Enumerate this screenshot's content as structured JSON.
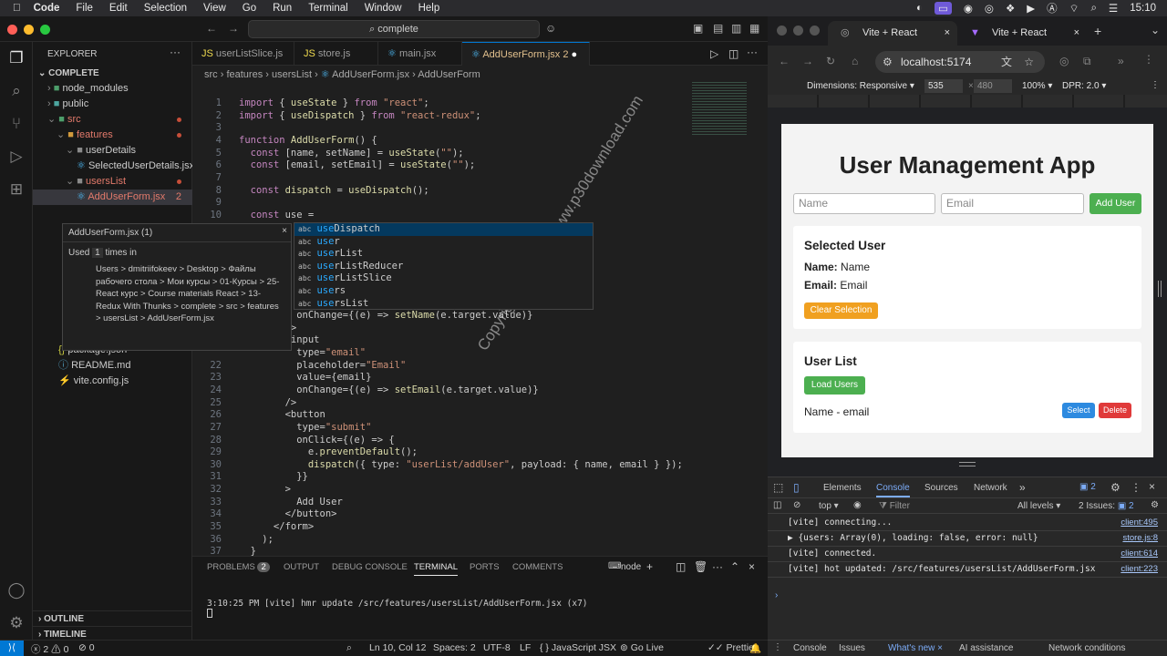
{
  "menubar": {
    "app": "Code",
    "items": [
      "File",
      "Edit",
      "Selection",
      "View",
      "Go",
      "Run",
      "Terminal",
      "Window",
      "Help"
    ],
    "clock": "15:10"
  },
  "vscode": {
    "command_center": "complete",
    "explorer_title": "EXPLORER",
    "project": "COMPLETE",
    "tree": [
      {
        "label": "node_modules",
        "depth": 1,
        "type": "folder"
      },
      {
        "label": "public",
        "depth": 1,
        "type": "folder"
      },
      {
        "label": "src",
        "depth": 1,
        "type": "folder-open"
      },
      {
        "label": "features",
        "depth": 2,
        "type": "folder-open"
      },
      {
        "label": "userDetails",
        "depth": 3,
        "type": "folder-open"
      },
      {
        "label": "SelectedUserDetails.jsx",
        "depth": 4,
        "type": "file"
      },
      {
        "label": "usersList",
        "depth": 3,
        "type": "folder-open"
      },
      {
        "label": "AddUserForm.jsx",
        "depth": 4,
        "type": "file",
        "badge": "2"
      }
    ],
    "tree_bottom": [
      {
        "label": "package.json"
      },
      {
        "label": "README.md"
      },
      {
        "label": "vite.config.js"
      }
    ],
    "outline": "OUTLINE",
    "timeline": "TIMELINE",
    "tabs": [
      {
        "label": "userListSlice.js"
      },
      {
        "label": "store.js"
      },
      {
        "label": "main.jsx"
      },
      {
        "label": "AddUserForm.jsx",
        "badge": "2"
      }
    ],
    "breadcrumbs": [
      "src",
      "features",
      "usersList",
      "AddUserForm.jsx",
      "AddUserForm"
    ],
    "code": [
      {
        "n": "1",
        "text": "import { useState } from \"react\";"
      },
      {
        "n": "2",
        "text": "import { useDispatch } from \"react-redux\";"
      },
      {
        "n": "3",
        "text": ""
      },
      {
        "n": "4",
        "text": "function AddUserForm() {"
      },
      {
        "n": "5",
        "text": "  const [name, setName] = useState(\"\");"
      },
      {
        "n": "6",
        "text": "  const [email, setEmail] = useState(\"\");"
      },
      {
        "n": "7",
        "text": ""
      },
      {
        "n": "8",
        "text": "  const dispatch = useDispatch();"
      },
      {
        "n": "9",
        "text": ""
      },
      {
        "n": "10",
        "text": "  const use ="
      }
    ],
    "code_lower": [
      {
        "n": "",
        "text": "          onChange={(e) => setName(e.target.value)}"
      },
      {
        "n": "",
        "text": "        />"
      },
      {
        "n": "",
        "text": "        <input"
      },
      {
        "n": "",
        "text": "          type=\"email\""
      },
      {
        "n": "22",
        "text": "          placeholder=\"Email\""
      },
      {
        "n": "23",
        "text": "          value={email}"
      },
      {
        "n": "24",
        "text": "          onChange={(e) => setEmail(e.target.value)}"
      },
      {
        "n": "25",
        "text": "        />"
      },
      {
        "n": "26",
        "text": "        <button"
      },
      {
        "n": "27",
        "text": "          type=\"submit\""
      },
      {
        "n": "28",
        "text": "          onClick={(e) => {"
      },
      {
        "n": "29",
        "text": "            e.preventDefault();"
      },
      {
        "n": "30",
        "text": "            dispatch({ type: \"userList/addUser\", payload: { name, email } });"
      },
      {
        "n": "31",
        "text": "          }}"
      },
      {
        "n": "32",
        "text": "        >"
      },
      {
        "n": "33",
        "text": "          Add User"
      },
      {
        "n": "34",
        "text": "        </button>"
      },
      {
        "n": "35",
        "text": "      </form>"
      },
      {
        "n": "36",
        "text": "    );"
      },
      {
        "n": "37",
        "text": "  }"
      }
    ],
    "suggestions": [
      "useDispatch",
      "user",
      "userList",
      "userListReducer",
      "userListSlice",
      "users",
      "usersList"
    ],
    "hover": {
      "title": "AddUserForm.jsx (1)",
      "used": "Used",
      "count": "1",
      "times": "times in",
      "path": "Users > dmitriifokeev > Desktop > Файлы рабочего стола > Мои курсы > 01-Курсы > 25-React курс > Course materials React > 13-Redux With Thunks > complete > src > features > usersList > AddUserForm.jsx"
    },
    "panel_tabs": [
      "PROBLEMS",
      "OUTPUT",
      "DEBUG CONSOLE",
      "TERMINAL",
      "PORTS",
      "COMMENTS"
    ],
    "problems_count": "2",
    "terminal_shell": "node",
    "terminal_line": "3:10:25 PM [vite] hmr update /src/features/usersList/AddUserForm.jsx (x7)",
    "status": {
      "errors": "2",
      "warnings": "0",
      "ports": "0",
      "position": "Ln 10, Col 12",
      "spaces": "Spaces: 2",
      "encoding": "UTF-8",
      "eol": "LF",
      "language": "JavaScript JSX",
      "golive": "Go Live",
      "prettier": "Prettier"
    },
    "watermark": "Copyright © 2025 - www.p30download.com"
  },
  "chrome": {
    "tabs": [
      {
        "label": "Vite + React"
      },
      {
        "label": "Vite + React"
      }
    ],
    "url": "localhost:5174",
    "device": {
      "dimensions": "Dimensions: Responsive",
      "width": "535",
      "height": "480",
      "zoom": "100%",
      "dpr": "DPR: 2.0"
    },
    "page": {
      "title": "User Management App",
      "name_placeholder": "Name",
      "email_placeholder": "Email",
      "add_button": "Add User",
      "selected_title": "Selected User",
      "name_label": "Name:",
      "name_value": "Name",
      "email_label": "Email:",
      "email_value": "Email",
      "clear_button": "Clear Selection",
      "list_title": "User List",
      "load_button": "Load Users",
      "row_text": "Name - email",
      "select_button": "Select",
      "delete_button": "Delete"
    },
    "devtools": {
      "tabs": [
        "Elements",
        "Console",
        "Sources",
        "Network"
      ],
      "issues_badge": "2",
      "context": "top",
      "filter": "Filter",
      "levels": "All levels",
      "issues": "2 Issues:",
      "issues_count": "2",
      "logs": [
        {
          "text": "[vite] connecting...",
          "src": "client:495"
        },
        {
          "text": "▶ {users: Array(0), loading: false, error: null}",
          "src": "store.js:8"
        },
        {
          "text": "[vite] connected.",
          "src": "client:614"
        },
        {
          "text": "[vite] hot updated: /src/features/usersList/AddUserForm.jsx",
          "src": "client:223"
        }
      ],
      "drawer_tabs": [
        "Console",
        "Issues",
        "What's new",
        "AI assistance",
        "Network conditions"
      ]
    }
  }
}
